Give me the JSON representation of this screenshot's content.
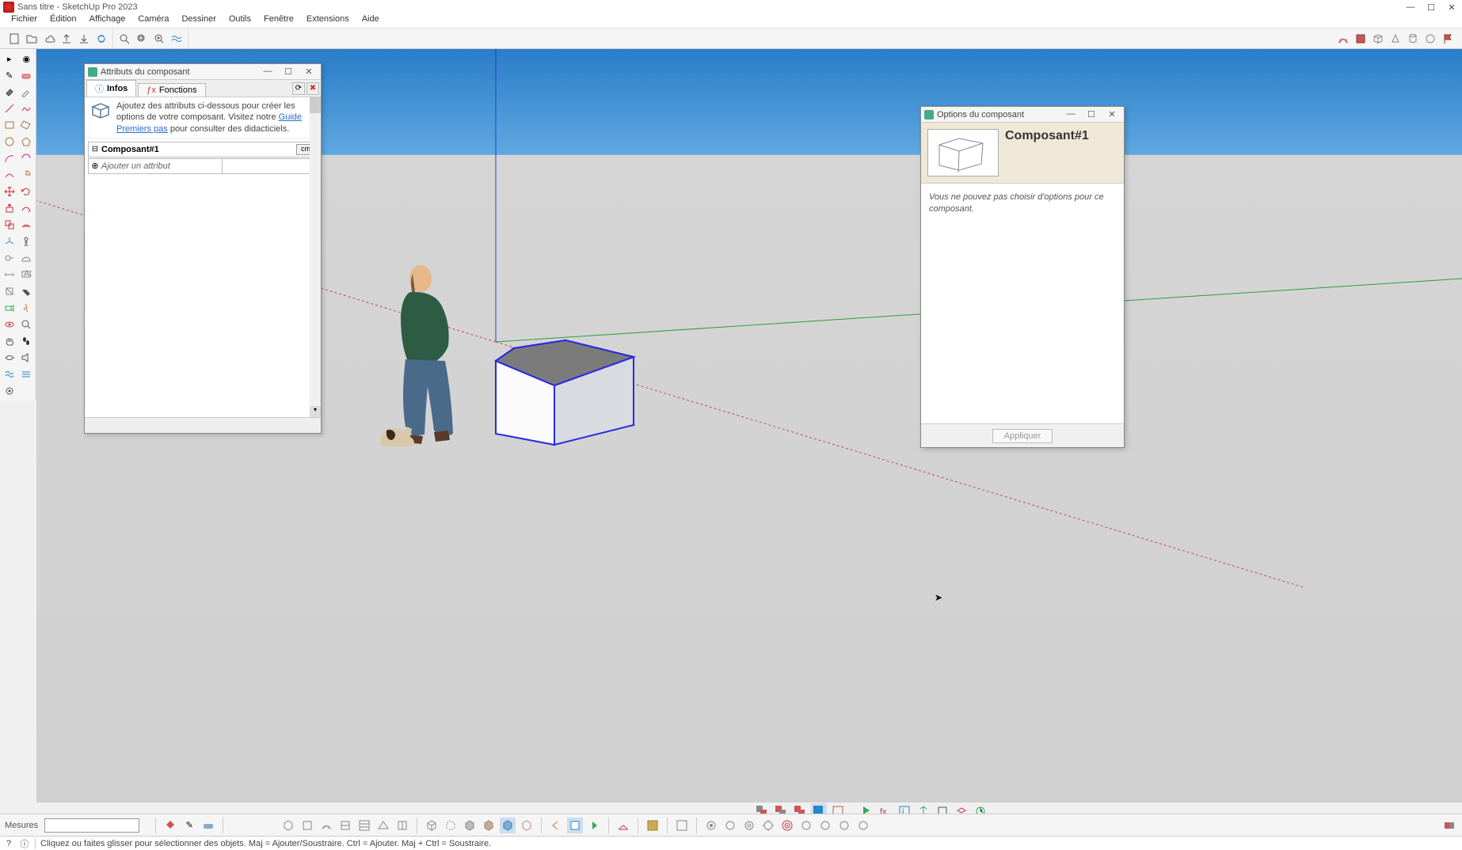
{
  "titlebar": {
    "title": "Sans titre - SketchUp Pro 2023"
  },
  "menu": [
    "Fichier",
    "Édition",
    "Affichage",
    "Caméra",
    "Dessiner",
    "Outils",
    "Fenêtre",
    "Extensions",
    "Aide"
  ],
  "attr_win": {
    "title": "Attributs du composant",
    "tabs": {
      "infos": "Infos",
      "fonctions": "Fonctions"
    },
    "help_pre": "Ajoutez des attributs ci-dessous pour créer les options de votre composant. Visitez notre ",
    "help_link": "Guide Premiers pas",
    "help_post": " pour consulter des didacticiels.",
    "component_name": "Composant#1",
    "unit": "cm",
    "add_placeholder": "Ajouter un attribut"
  },
  "opt_win": {
    "title": "Options du composant",
    "name": "Composant#1",
    "body": "Vous ne pouvez pas choisir d'options pour ce composant.",
    "apply": "Appliquer"
  },
  "bottom": {
    "measure_label": "Mesures"
  },
  "status": {
    "hint": "Cliquez ou faites glisser pour sélectionner des objets. Maj = Ajouter/Soustraire. Ctrl = Ajouter. Maj + Ctrl = Soustraire."
  }
}
